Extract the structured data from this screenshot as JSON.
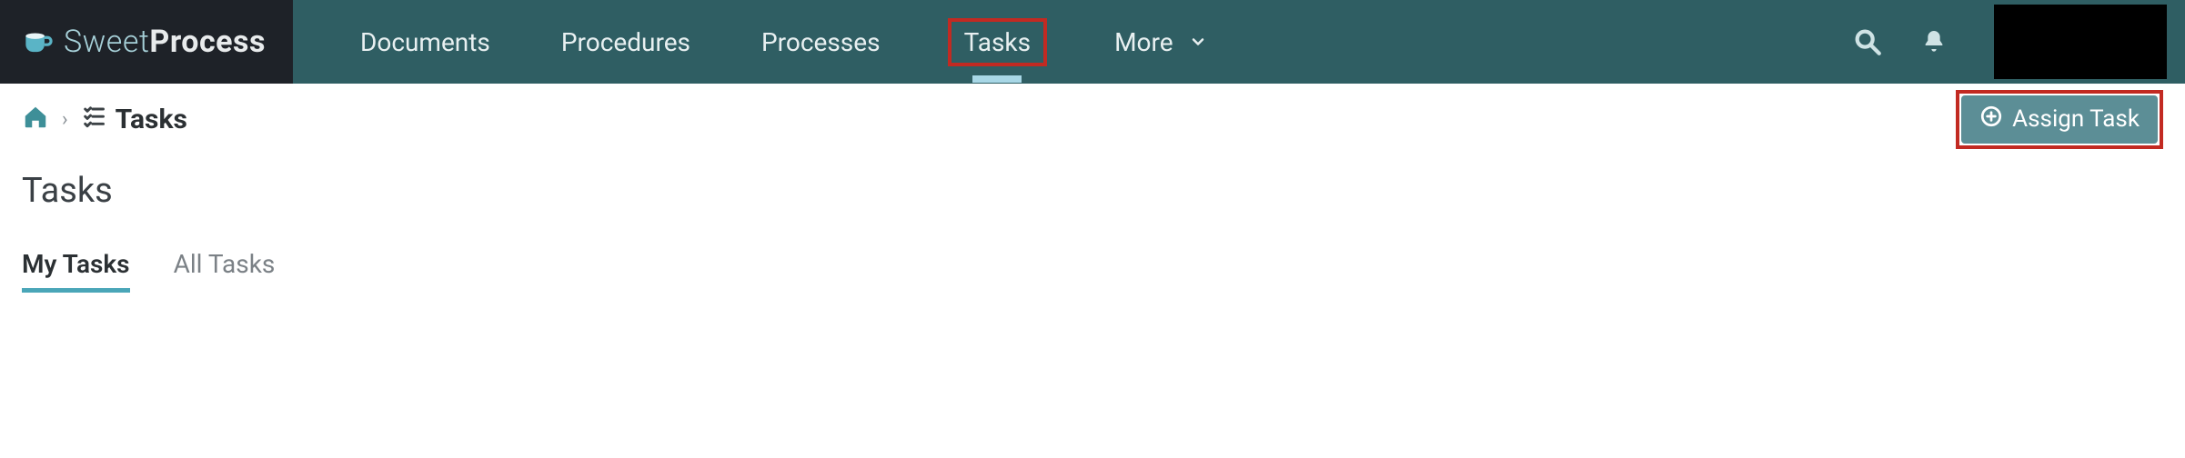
{
  "brand": {
    "light": "Sweet",
    "bold": "Process"
  },
  "nav": {
    "items": [
      {
        "label": "Documents"
      },
      {
        "label": "Procedures"
      },
      {
        "label": "Processes"
      },
      {
        "label": "Tasks"
      },
      {
        "label": "More"
      }
    ]
  },
  "breadcrumb": {
    "current": "Tasks"
  },
  "actions": {
    "assign_label": "Assign Task"
  },
  "page": {
    "title": "Tasks"
  },
  "tabs": [
    {
      "label": "My Tasks"
    },
    {
      "label": "All Tasks"
    }
  ]
}
